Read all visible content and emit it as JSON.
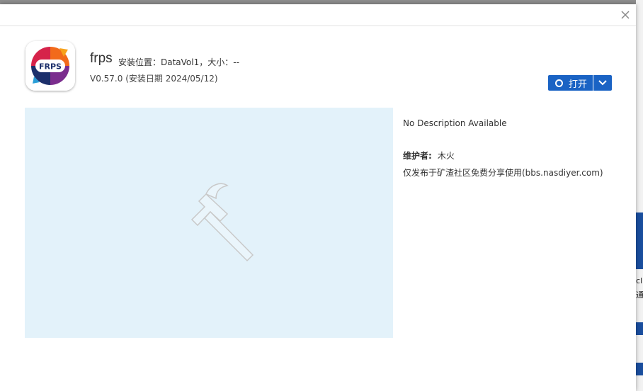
{
  "background": {
    "partial_text_1": "cl",
    "partial_text_2": "通"
  },
  "dialog": {
    "close_icon": "close-icon",
    "app": {
      "icon_text": "FRPS",
      "name": "frps",
      "install_location": "安装位置：DataVol1，大小：--",
      "version": "V0.57.0 (安装日期 2024/05/12)"
    },
    "open_button": {
      "label": "打开",
      "icon": "circle-icon",
      "dropdown_icon": "chevron-down-icon"
    },
    "screenshot_placeholder_icon": "hammer-icon",
    "description": "No Description Available",
    "maintainer": {
      "label": "维护者:",
      "value": "木火"
    },
    "note": "仅发布于矿渣社区免费分享使用(bbs.nasdiyer.com)"
  },
  "colors": {
    "accent": "#1a63c4",
    "screenshot_bg": "#e3f2fa",
    "overlay": "#8e8e8e"
  }
}
